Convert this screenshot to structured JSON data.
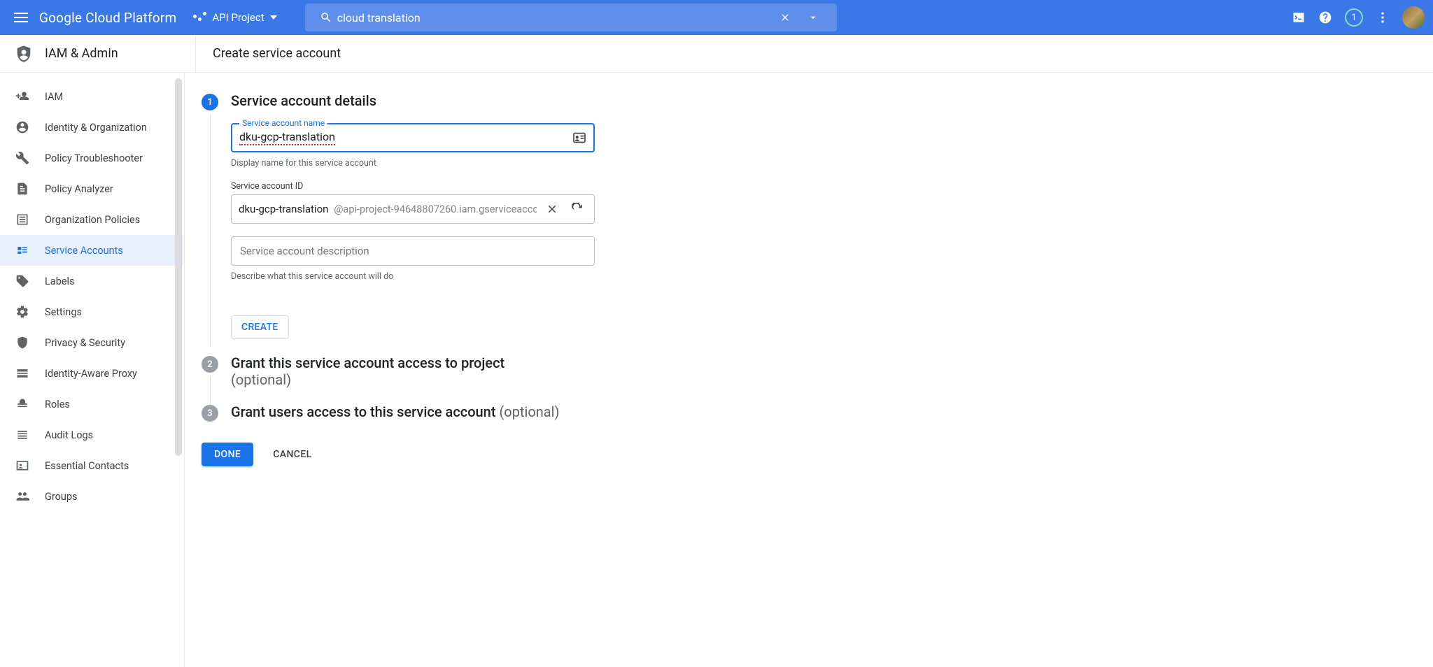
{
  "header": {
    "brand": "Google Cloud Platform",
    "project": "API Project",
    "search_value": "cloud translation",
    "notif_count": "1"
  },
  "section": {
    "product": "IAM & Admin",
    "page_title": "Create service account"
  },
  "sidebar": {
    "items": [
      {
        "label": "IAM"
      },
      {
        "label": "Identity & Organization"
      },
      {
        "label": "Policy Troubleshooter"
      },
      {
        "label": "Policy Analyzer"
      },
      {
        "label": "Organization Policies"
      },
      {
        "label": "Service Accounts"
      },
      {
        "label": "Labels"
      },
      {
        "label": "Settings"
      },
      {
        "label": "Privacy & Security"
      },
      {
        "label": "Identity-Aware Proxy"
      },
      {
        "label": "Roles"
      },
      {
        "label": "Audit Logs"
      },
      {
        "label": "Essential Contacts"
      },
      {
        "label": "Groups"
      }
    ]
  },
  "steps": {
    "s1": {
      "num": "1",
      "title": "Service account details",
      "name_label": "Service account name",
      "name_value": "dku-gcp-translation",
      "name_helper": "Display name for this service account",
      "id_label": "Service account ID",
      "id_value": "dku-gcp-translation",
      "id_suffix": "@api-project-94648807260.iam.gserviceacco",
      "desc_placeholder": "Service account description",
      "desc_helper": "Describe what this service account will do",
      "create": "CREATE"
    },
    "s2": {
      "num": "2",
      "title": "Grant this service account access to project",
      "optional": "(optional)"
    },
    "s3": {
      "num": "3",
      "title": "Grant users access to this service account ",
      "optional": "(optional)"
    }
  },
  "actions": {
    "done": "DONE",
    "cancel": "CANCEL"
  }
}
